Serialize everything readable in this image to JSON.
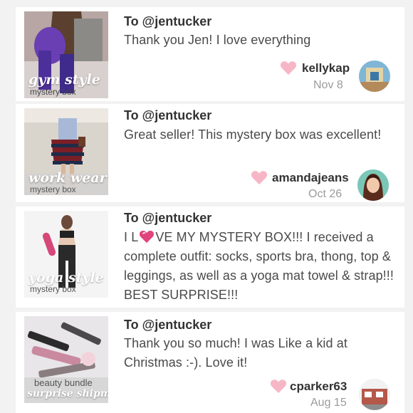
{
  "reviews": [
    {
      "to": "To @jentucker",
      "message": "Thank you Jen! I love everything",
      "thumb_title": "gym style",
      "thumb_sub": "mystery box",
      "username": "kellykap",
      "date": "Nov 8"
    },
    {
      "to": "To @jentucker",
      "message": "Great seller! This mystery box was excellent!",
      "thumb_title": "work wear",
      "thumb_sub": "mystery box",
      "username": "amandajeans",
      "date": "Oct 26"
    },
    {
      "to": "To @jentucker",
      "message_prefix": "I L",
      "message_suffix": "VE MY MYSTERY BOX!!! I received a complete outfit: socks, sports bra, thong, top & leggings, as well as a yoga mat towel & strap!!! BEST SURPRISE!!!",
      "thumb_title": "yoga style",
      "thumb_sub": "mystery box"
    },
    {
      "to": "To @jentucker",
      "message": "Thank you so much! I was Like a kid at Christmas :-). Love it!",
      "thumb_title": "surprise shipment",
      "thumb_sub": "beauty bundle",
      "username": "cparker63",
      "date": "Aug 15"
    }
  ],
  "colors": {
    "heart_pink": "#f7b6c6",
    "heart_emoji": "#e0457b",
    "username": "#333333",
    "date": "#9b9b9b",
    "background": "#f2f2f2"
  },
  "icons": [
    "heart-icon",
    "heart-emoji-icon",
    "avatar"
  ]
}
